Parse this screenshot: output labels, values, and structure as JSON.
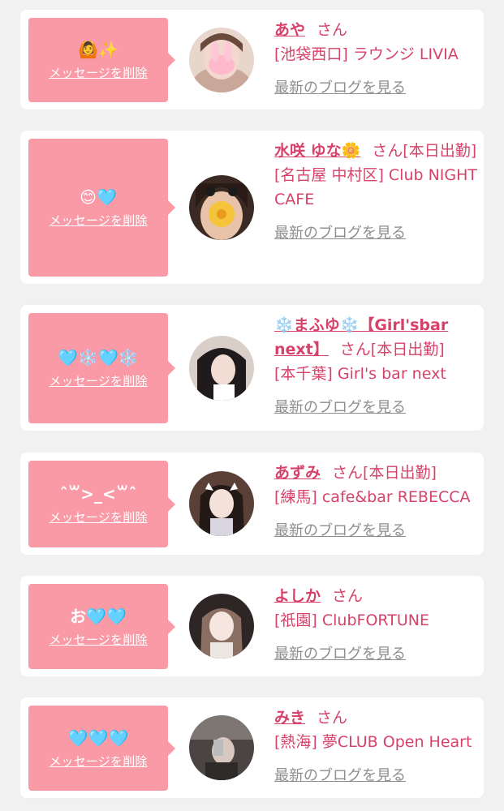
{
  "delete_label": "メッセージを削除",
  "blog_label": "最新のブログを見る",
  "san_label": "さん",
  "colors": {
    "accent": "#d7426a",
    "bubble": "#fb9aa7",
    "heart": "#7cc9f2",
    "link_gray": "#8e8e8e"
  },
  "cards": [
    {
      "message": "🙆✨",
      "name": "あや",
      "status": "",
      "shop": "[池袋西口] ラウンジ LIVIA",
      "avatar_icon": "profile-photo"
    },
    {
      "message": "😊🩵",
      "name": "水咲 ゆな🌼",
      "status": "[本日出勤]",
      "shop": "[名古屋 中村区] Club NIGHT CAFE",
      "avatar_icon": "profile-photo"
    },
    {
      "message": "🩵❄️🩵❄️",
      "name": "❄️まふゆ❄️【Girl'sbar next】",
      "status": "[本日出勤]",
      "shop": "[本千葉] Girl's bar next",
      "avatar_icon": "profile-photo"
    },
    {
      "message": "ˆ꒳>_<꒳ˆ",
      "name": "あずみ",
      "status": "[本日出勤]",
      "shop": "[練馬] cafe&bar REBECCA",
      "avatar_icon": "profile-photo"
    },
    {
      "message": "お🩵🩵",
      "name": "よしか",
      "status": "",
      "shop": "[祇園] ClubFORTUNE",
      "avatar_icon": "profile-photo"
    },
    {
      "message": "🩵🩵🩵",
      "name": "みき",
      "status": "",
      "shop": "[熱海] 夢CLUB Open Heart",
      "avatar_icon": "profile-photo"
    }
  ]
}
